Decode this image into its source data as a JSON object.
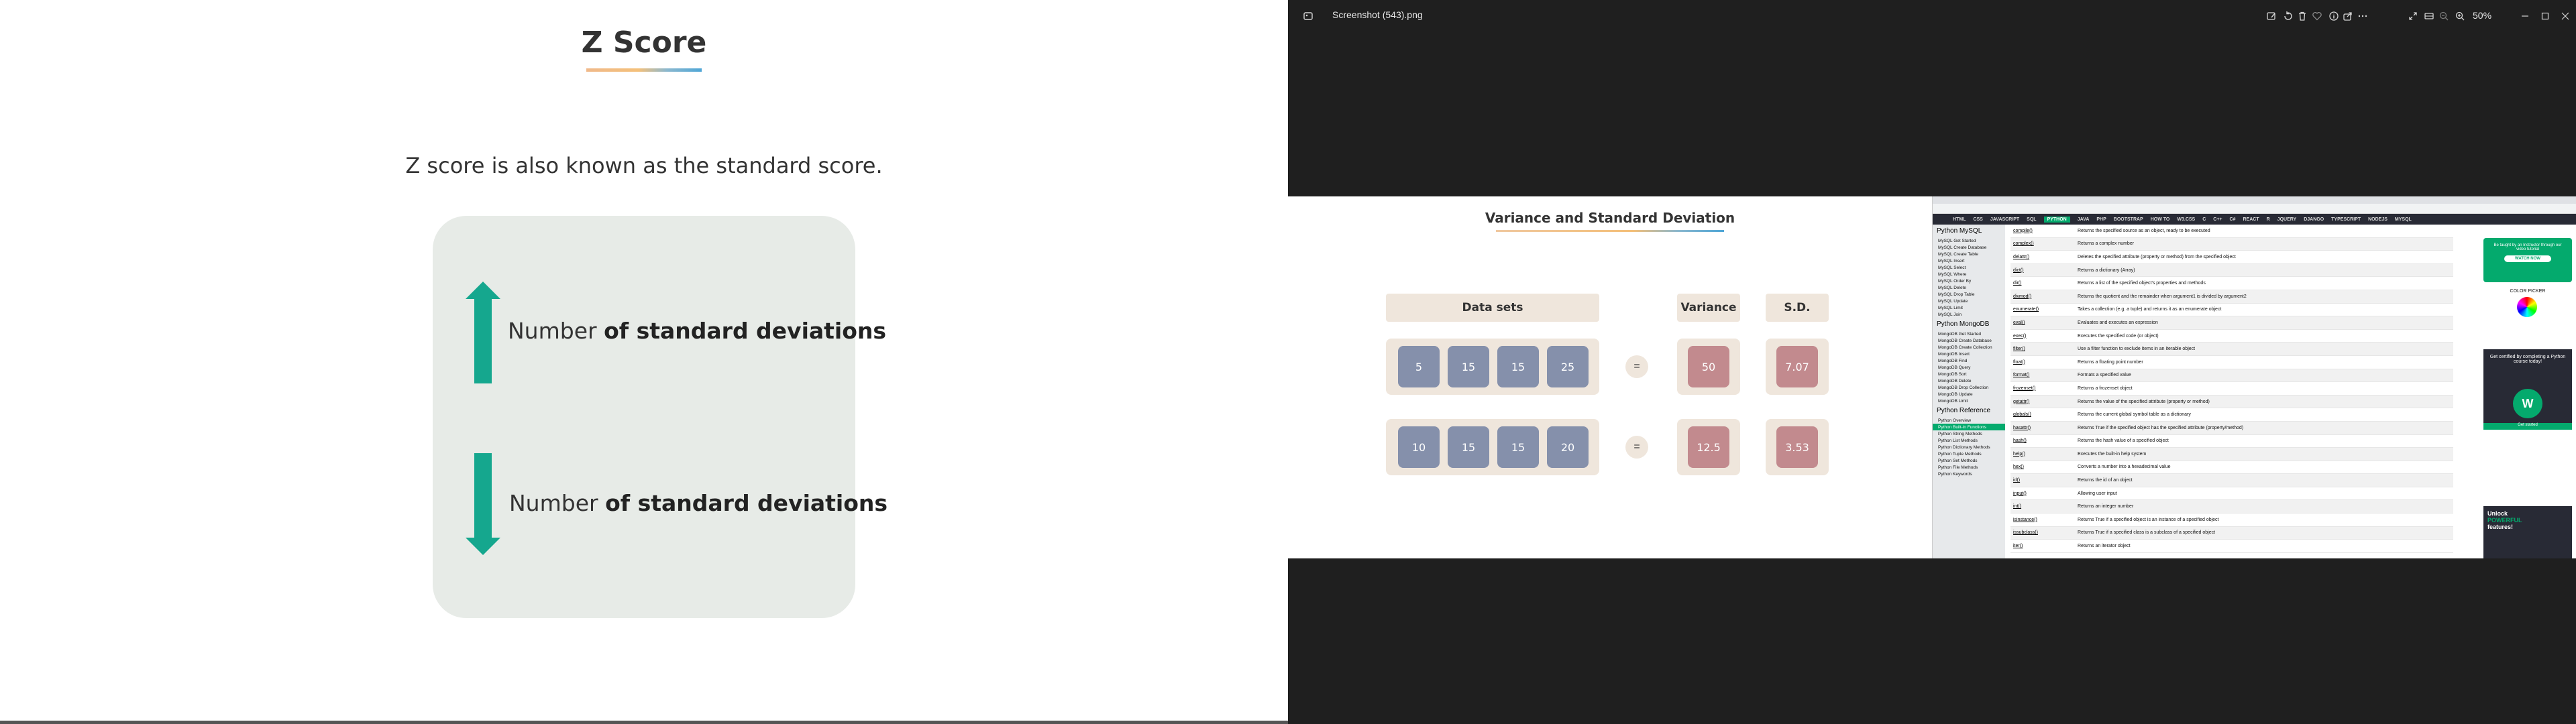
{
  "slide": {
    "title": "Z Score",
    "intro": "Z score is also known as the standard score.",
    "label_up_plain": "Number",
    "label_up_bold": "of standard deviations",
    "label_down_plain": "Number",
    "label_down_bold": "of standard deviations",
    "colors": {
      "arrow": "#15a78e",
      "card": "#e7ebe7"
    }
  },
  "viewer": {
    "file_title": "Screenshot (543).png",
    "zoom": "50%",
    "toolbar_icons": [
      "edit-icon",
      "rotate-icon",
      "delete-icon",
      "favorite-icon",
      "info-icon",
      "share-icon",
      "more-icon"
    ],
    "right_icons": [
      "fullscreen-icon",
      "filmstrip-icon",
      "zoom-out-icon",
      "zoom-in-icon"
    ],
    "window_controls": [
      "minimize-icon",
      "maximize-icon",
      "close-icon"
    ]
  },
  "inner_slide": {
    "title": "Variance and Standard Deviation",
    "headers": {
      "datasets": "Data sets",
      "variance": "Variance",
      "sd": "S.D."
    },
    "rows": [
      {
        "values": [
          "5",
          "15",
          "15",
          "25"
        ],
        "eq": "=",
        "variance": "50",
        "sd": "7.07"
      },
      {
        "values": [
          "10",
          "15",
          "15",
          "20"
        ],
        "eq": "=",
        "variance": "12.5",
        "sd": "3.53"
      }
    ]
  },
  "browser": {
    "nav": [
      "HTML",
      "CSS",
      "JAVASCRIPT",
      "SQL",
      "PYTHON",
      "JAVA",
      "PHP",
      "BOOTSTRAP",
      "HOW TO",
      "W3.CSS",
      "C",
      "C++",
      "C#",
      "REACT",
      "R",
      "JQUERY",
      "DJANGO",
      "TYPESCRIPT",
      "NODEJS",
      "MYSQL"
    ],
    "nav_active": "PYTHON",
    "side_sections": [
      {
        "head": "Python MySQL",
        "items": [
          "MySQL Get Started",
          "MySQL Create Database",
          "MySQL Create Table",
          "MySQL Insert",
          "MySQL Select",
          "MySQL Where",
          "MySQL Order By",
          "MySQL Delete",
          "MySQL Drop Table",
          "MySQL Update",
          "MySQL Limit",
          "MySQL Join"
        ]
      },
      {
        "head": "Python MongoDB",
        "items": [
          "MongoDB Get Started",
          "MongoDB Create Database",
          "MongoDB Create Collection",
          "MongoDB Insert",
          "MongoDB Find",
          "MongoDB Query",
          "MongoDB Sort",
          "MongoDB Delete",
          "MongoDB Drop Collection",
          "MongoDB Update",
          "MongoDB Limit"
        ]
      },
      {
        "head": "Python Reference",
        "items": [
          "Python Overview",
          "Python Built-in Functions",
          "Python String Methods",
          "Python List Methods",
          "Python Dictionary Methods",
          "Python Tuple Methods",
          "Python Set Methods",
          "Python File Methods",
          "Python Keywords"
        ]
      }
    ],
    "side_active": "Python Built-in Functions",
    "functions": [
      {
        "name": "compile()",
        "desc": "Returns the specified source as an object, ready to be executed"
      },
      {
        "name": "complex()",
        "desc": "Returns a complex number"
      },
      {
        "name": "delattr()",
        "desc": "Deletes the specified attribute (property or method) from the specified object"
      },
      {
        "name": "dict()",
        "desc": "Returns a dictionary (Array)"
      },
      {
        "name": "dir()",
        "desc": "Returns a list of the specified object's properties and methods"
      },
      {
        "name": "divmod()",
        "desc": "Returns the quotient and the remainder when argument1 is divided by argument2"
      },
      {
        "name": "enumerate()",
        "desc": "Takes a collection (e.g. a tuple) and returns it as an enumerate object"
      },
      {
        "name": "eval()",
        "desc": "Evaluates and executes an expression"
      },
      {
        "name": "exec()",
        "desc": "Executes the specified code (or object)"
      },
      {
        "name": "filter()",
        "desc": "Use a filter function to exclude items in an iterable object"
      },
      {
        "name": "float()",
        "desc": "Returns a floating point number"
      },
      {
        "name": "format()",
        "desc": "Formats a specified value"
      },
      {
        "name": "frozenset()",
        "desc": "Returns a frozenset object"
      },
      {
        "name": "getattr()",
        "desc": "Returns the value of the specified attribute (property or method)"
      },
      {
        "name": "globals()",
        "desc": "Returns the current global symbol table as a dictionary"
      },
      {
        "name": "hasattr()",
        "desc": "Returns True if the specified object has the specified attribute (property/method)"
      },
      {
        "name": "hash()",
        "desc": "Returns the hash value of a specified object"
      },
      {
        "name": "help()",
        "desc": "Executes the built-in help system"
      },
      {
        "name": "hex()",
        "desc": "Converts a number into a hexadecimal value"
      },
      {
        "name": "id()",
        "desc": "Returns the id of an object"
      },
      {
        "name": "input()",
        "desc": "Allowing user input"
      },
      {
        "name": "int()",
        "desc": "Returns an integer number"
      },
      {
        "name": "isinstance()",
        "desc": "Returns True if a specified object is an instance of a specified object"
      },
      {
        "name": "issubclass()",
        "desc": "Returns True if a specified class is a subclass of a specified object"
      },
      {
        "name": "iter()",
        "desc": "Returns an iterator object"
      }
    ],
    "ad": {
      "video_text": "Be taught by an Instructor through our video tutorial",
      "watch": "WATCH NOW",
      "color_picker": "COLOR PICKER",
      "cert_text": "Get certified by completing a Python course today!",
      "get_started": "Get started",
      "unlock": "Unlock",
      "powerful": "POWERFUL",
      "features": "features!"
    }
  }
}
